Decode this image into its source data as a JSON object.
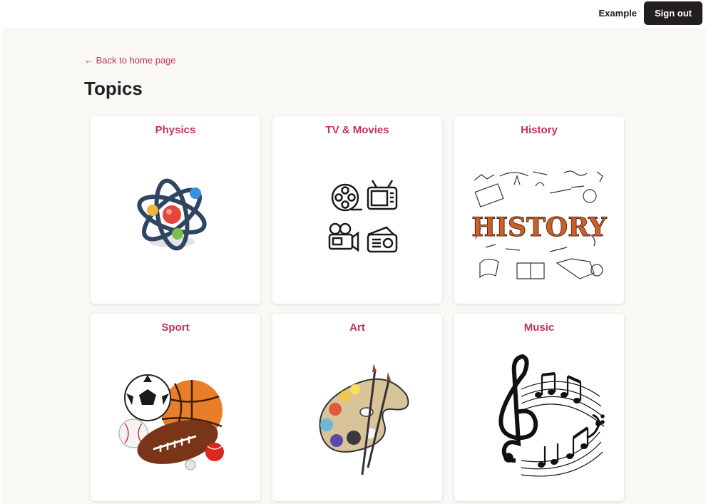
{
  "header": {
    "username": "Example",
    "sign_out_label": "Sign out"
  },
  "nav": {
    "back_link": "← Back to home page"
  },
  "page": {
    "title": "Topics"
  },
  "topics": [
    {
      "label": "Physics",
      "icon": "atom-icon"
    },
    {
      "label": "TV & Movies",
      "icon": "media-icons"
    },
    {
      "label": "History",
      "icon": "history-doodle"
    },
    {
      "label": "Sport",
      "icon": "sports-balls-icon"
    },
    {
      "label": "Art",
      "icon": "paint-palette-icon"
    },
    {
      "label": "Music",
      "icon": "music-notes-icon"
    }
  ],
  "colors": {
    "accent": "#c23454",
    "button_bg": "#231f20",
    "page_bg": "#f9f8f5"
  }
}
